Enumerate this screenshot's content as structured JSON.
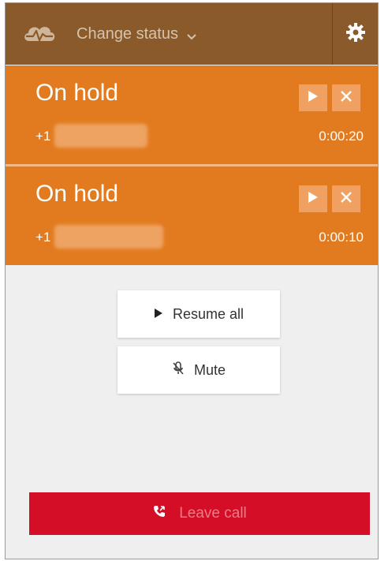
{
  "header": {
    "status_label": "Change status",
    "icons": {
      "logo": "cloud-pulse-logo",
      "dropdown": "chevron-down-icon",
      "settings": "gear-icon"
    }
  },
  "calls": [
    {
      "status": "On hold",
      "number": "+1",
      "duration": "0:00:20",
      "actions": [
        "play-icon",
        "close-icon"
      ]
    },
    {
      "status": "On hold",
      "number": "+1",
      "duration": "0:00:10",
      "actions": [
        "play-icon",
        "close-icon"
      ]
    }
  ],
  "controls": {
    "resume_all_label": "Resume all",
    "mute_label": "Mute",
    "leave_call_label": "Leave call"
  },
  "colors": {
    "header_bg": "#8b5a2b",
    "card_bg": "#e27b20",
    "leave_bg": "#d40e26",
    "panel_bg": "#efefef"
  }
}
